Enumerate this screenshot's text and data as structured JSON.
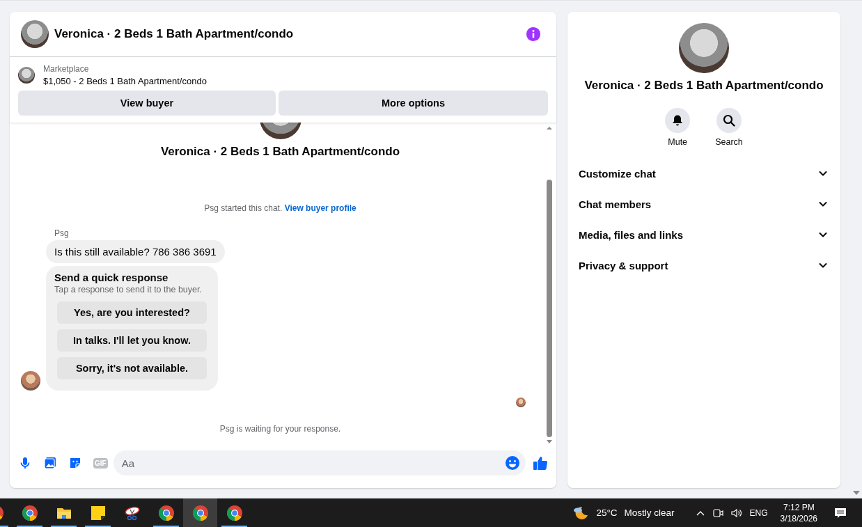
{
  "chat_header": {
    "title": "Veronica · 2 Beds 1 Bath Apartment/condo"
  },
  "listing": {
    "label": "Marketplace",
    "summary": "$1,050 - 2 Beds 1 Bath Apartment/condo",
    "buttons": [
      "View buyer",
      "More options"
    ]
  },
  "conversation": {
    "title": "Veronica · 2 Beds 1 Bath Apartment/condo",
    "notice": "Psg started this chat.",
    "notice_link": "View buyer profile",
    "sender": "Psg",
    "message": "Is this still available? 786 386 3691",
    "quick_response": {
      "title": "Send a quick response",
      "subtitle": "Tap a response to send it to the buyer.",
      "options": [
        "Yes, are you interested?",
        "In talks. I'll let you know.",
        "Sorry, it's not available."
      ]
    },
    "status": "Psg is waiting for your response."
  },
  "composer": {
    "placeholder": "Aa",
    "gif_label": "GIF"
  },
  "details": {
    "title": "Veronica · 2 Beds 1 Bath Apartment/condo",
    "actions": [
      {
        "kind": "bell",
        "label": "Mute"
      },
      {
        "kind": "search",
        "label": "Search"
      }
    ],
    "sections": [
      {
        "label": "Customize chat",
        "expanded": false
      },
      {
        "label": "Chat members",
        "expanded": false
      },
      {
        "label": "Media, files and links",
        "expanded": false
      },
      {
        "label": "Privacy & support",
        "expanded": false
      }
    ]
  },
  "taskbar": {
    "apps": [
      {
        "kind": "partial",
        "selected": false,
        "running": true
      },
      {
        "kind": "browser",
        "selected": false,
        "running": true
      },
      {
        "kind": "folder",
        "selected": false,
        "running": true
      },
      {
        "kind": "notes",
        "selected": false,
        "running": true
      },
      {
        "kind": "snip",
        "selected": false,
        "running": false
      },
      {
        "kind": "browser",
        "selected": false,
        "running": true
      },
      {
        "kind": "browser",
        "selected": true,
        "running": false
      },
      {
        "kind": "browser",
        "selected": false,
        "running": true
      }
    ],
    "weather": {
      "temperature": "25°C",
      "condition": "Mostly clear"
    },
    "language": "ENG",
    "time": "7:12 PM",
    "date": "3/18/2026"
  }
}
